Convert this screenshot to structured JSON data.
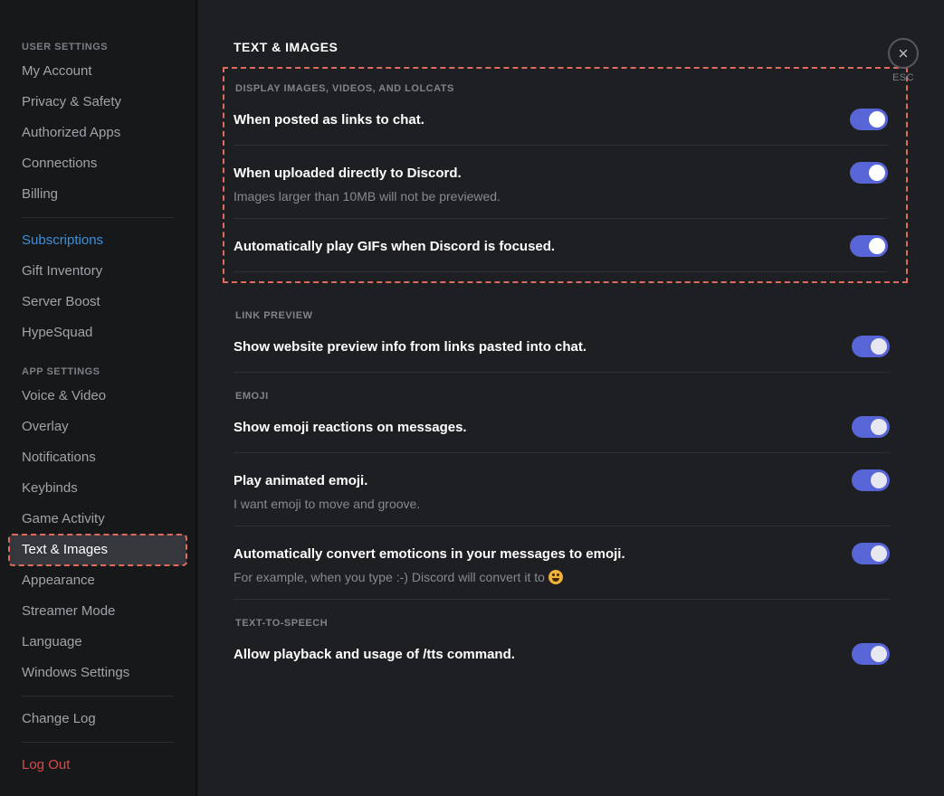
{
  "sidebar": {
    "cat_user": "USER SETTINGS",
    "cat_app": "APP SETTINGS",
    "items": {
      "my_account": "My Account",
      "privacy": "Privacy & Safety",
      "authorized_apps": "Authorized Apps",
      "connections": "Connections",
      "billing": "Billing",
      "subscriptions": "Subscriptions",
      "gift_inventory": "Gift Inventory",
      "server_boost": "Server Boost",
      "hypesquad": "HypeSquad",
      "voice_video": "Voice & Video",
      "overlay": "Overlay",
      "notifications": "Notifications",
      "keybinds": "Keybinds",
      "game_activity": "Game Activity",
      "text_images": "Text & Images",
      "appearance": "Appearance",
      "streamer_mode": "Streamer Mode",
      "language": "Language",
      "windows_settings": "Windows Settings",
      "change_log": "Change Log",
      "log_out": "Log Out"
    }
  },
  "main": {
    "title": "TEXT & IMAGES",
    "section_display": "DISPLAY IMAGES, VIDEOS, AND LOLCATS",
    "posted_links": "When posted as links to chat.",
    "uploaded_direct": "When uploaded directly to Discord.",
    "uploaded_direct_desc": "Images larger than 10MB will not be previewed.",
    "auto_gif": "Automatically play GIFs when Discord is focused.",
    "section_link": "LINK PREVIEW",
    "link_preview": "Show website preview info from links pasted into chat.",
    "section_emoji": "EMOJI",
    "emoji_reactions": "Show emoji reactions on messages.",
    "animated_emoji": "Play animated emoji.",
    "animated_emoji_desc": "I want emoji to move and groove.",
    "convert_emoticons": "Automatically convert emoticons in your messages to emoji.",
    "convert_emoticons_desc": "For example, when you type :-) Discord will convert it to ",
    "section_tts": "TEXT-TO-SPEECH",
    "tts": "Allow playback and usage of /tts command."
  },
  "close": {
    "label": "ESC"
  },
  "toggles": {
    "posted_links": true,
    "uploaded_direct": true,
    "auto_gif": true,
    "link_preview": true,
    "emoji_reactions": true,
    "animated_emoji": true,
    "convert_emoticons": true,
    "tts": true
  }
}
